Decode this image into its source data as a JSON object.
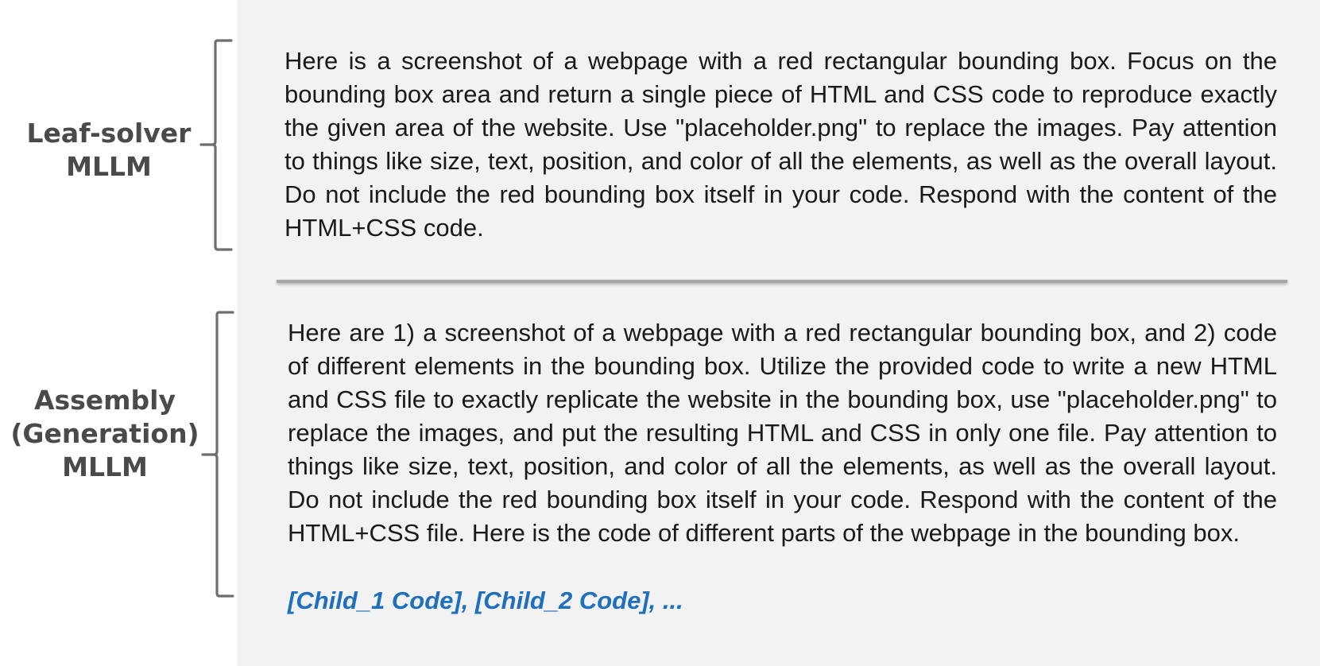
{
  "leaf_solver": {
    "label": "Leaf-solver MLLM",
    "prompt": "Here is a screenshot of a webpage with a red rectangular bounding box. Focus on the bounding box area and return a single piece of HTML and CSS code to reproduce exactly the given area of the website. Use \"placeholder.png\" to replace the images. Pay attention to things like size, text, position, and color of all the elements, as well as the overall layout. Do not include the red bounding box itself in your code. Respond with the content of the HTML+CSS code."
  },
  "assembly": {
    "label": "Assembly (Generation) MLLM",
    "prompt": "Here are 1) a screenshot of a webpage with a red rectangular bounding box, and 2) code of different elements in the bounding box. Utilize the provided code to write a new HTML and CSS file to exactly replicate the website in the bounding box, use \"placeholder.png\" to replace the images, and put the resulting HTML and CSS in only one file. Pay attention to things like size, text, position, and color of all the elements, as well as the overall layout. Do not include the red bounding box itself in your code. Respond with the content of the HTML+CSS file. Here is the code of different parts of the webpage in the bounding box.",
    "child_code": "[Child_1 Code], [Child_2 Code], ..."
  },
  "colors": {
    "panel_background": "#f2f2f2",
    "label_text": "#4a4a4a",
    "brace": "#6e6e6e",
    "child_code": "#1f6fbf",
    "divider": "#a6a6a6"
  }
}
